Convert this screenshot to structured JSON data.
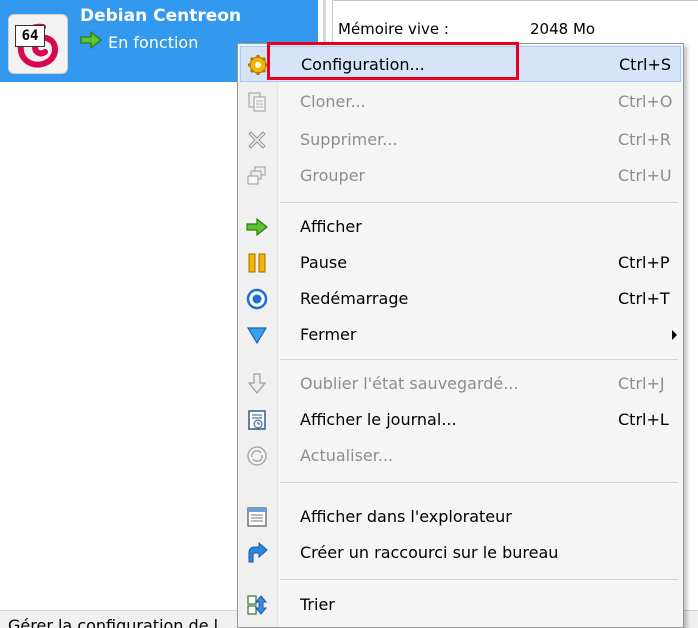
{
  "vm": {
    "badge": "64",
    "name": "Debian Centreon",
    "state": "En fonction"
  },
  "details": {
    "ram_label": "Mémoire vive :",
    "ram_value": "2048 Mo"
  },
  "statusbar": {
    "text": "Gérer la configuration de l"
  },
  "menu": {
    "items": [
      {
        "label": "Configuration...",
        "shortcut": "Ctrl+S",
        "icon": "gear-icon"
      },
      {
        "label": "Cloner...",
        "shortcut": "Ctrl+O",
        "icon": "clone-icon"
      },
      {
        "label": "Supprimer...",
        "shortcut": "Ctrl+R",
        "icon": "remove-icon"
      },
      {
        "label": "Grouper",
        "shortcut": "Ctrl+U",
        "icon": "group-icon"
      },
      {
        "label": "Afficher",
        "shortcut": "",
        "icon": "show-arrow-icon"
      },
      {
        "label": "Pause",
        "shortcut": "Ctrl+P",
        "icon": "pause-icon"
      },
      {
        "label": "Redémarrage",
        "shortcut": "Ctrl+T",
        "icon": "reset-icon"
      },
      {
        "label": "Fermer",
        "shortcut": "",
        "icon": "close-triangle-icon"
      },
      {
        "label": "Oublier l'état sauvegardé...",
        "shortcut": "Ctrl+J",
        "icon": "discard-state-icon"
      },
      {
        "label": "Afficher le journal...",
        "shortcut": "Ctrl+L",
        "icon": "log-icon"
      },
      {
        "label": "Actualiser...",
        "shortcut": "",
        "icon": "refresh-icon"
      },
      {
        "label": "Afficher dans l'explorateur",
        "shortcut": "",
        "icon": "explorer-icon"
      },
      {
        "label": "Créer un raccourci sur le bureau",
        "shortcut": "",
        "icon": "shortcut-icon"
      },
      {
        "label": "Trier",
        "shortcut": "",
        "icon": "sort-icon"
      }
    ]
  },
  "colors": {
    "selection": "#3399ee",
    "highlight_box": "#e8001c",
    "menu_hover": "#d5e5f7",
    "disabled_text": "#8d8d8d"
  }
}
